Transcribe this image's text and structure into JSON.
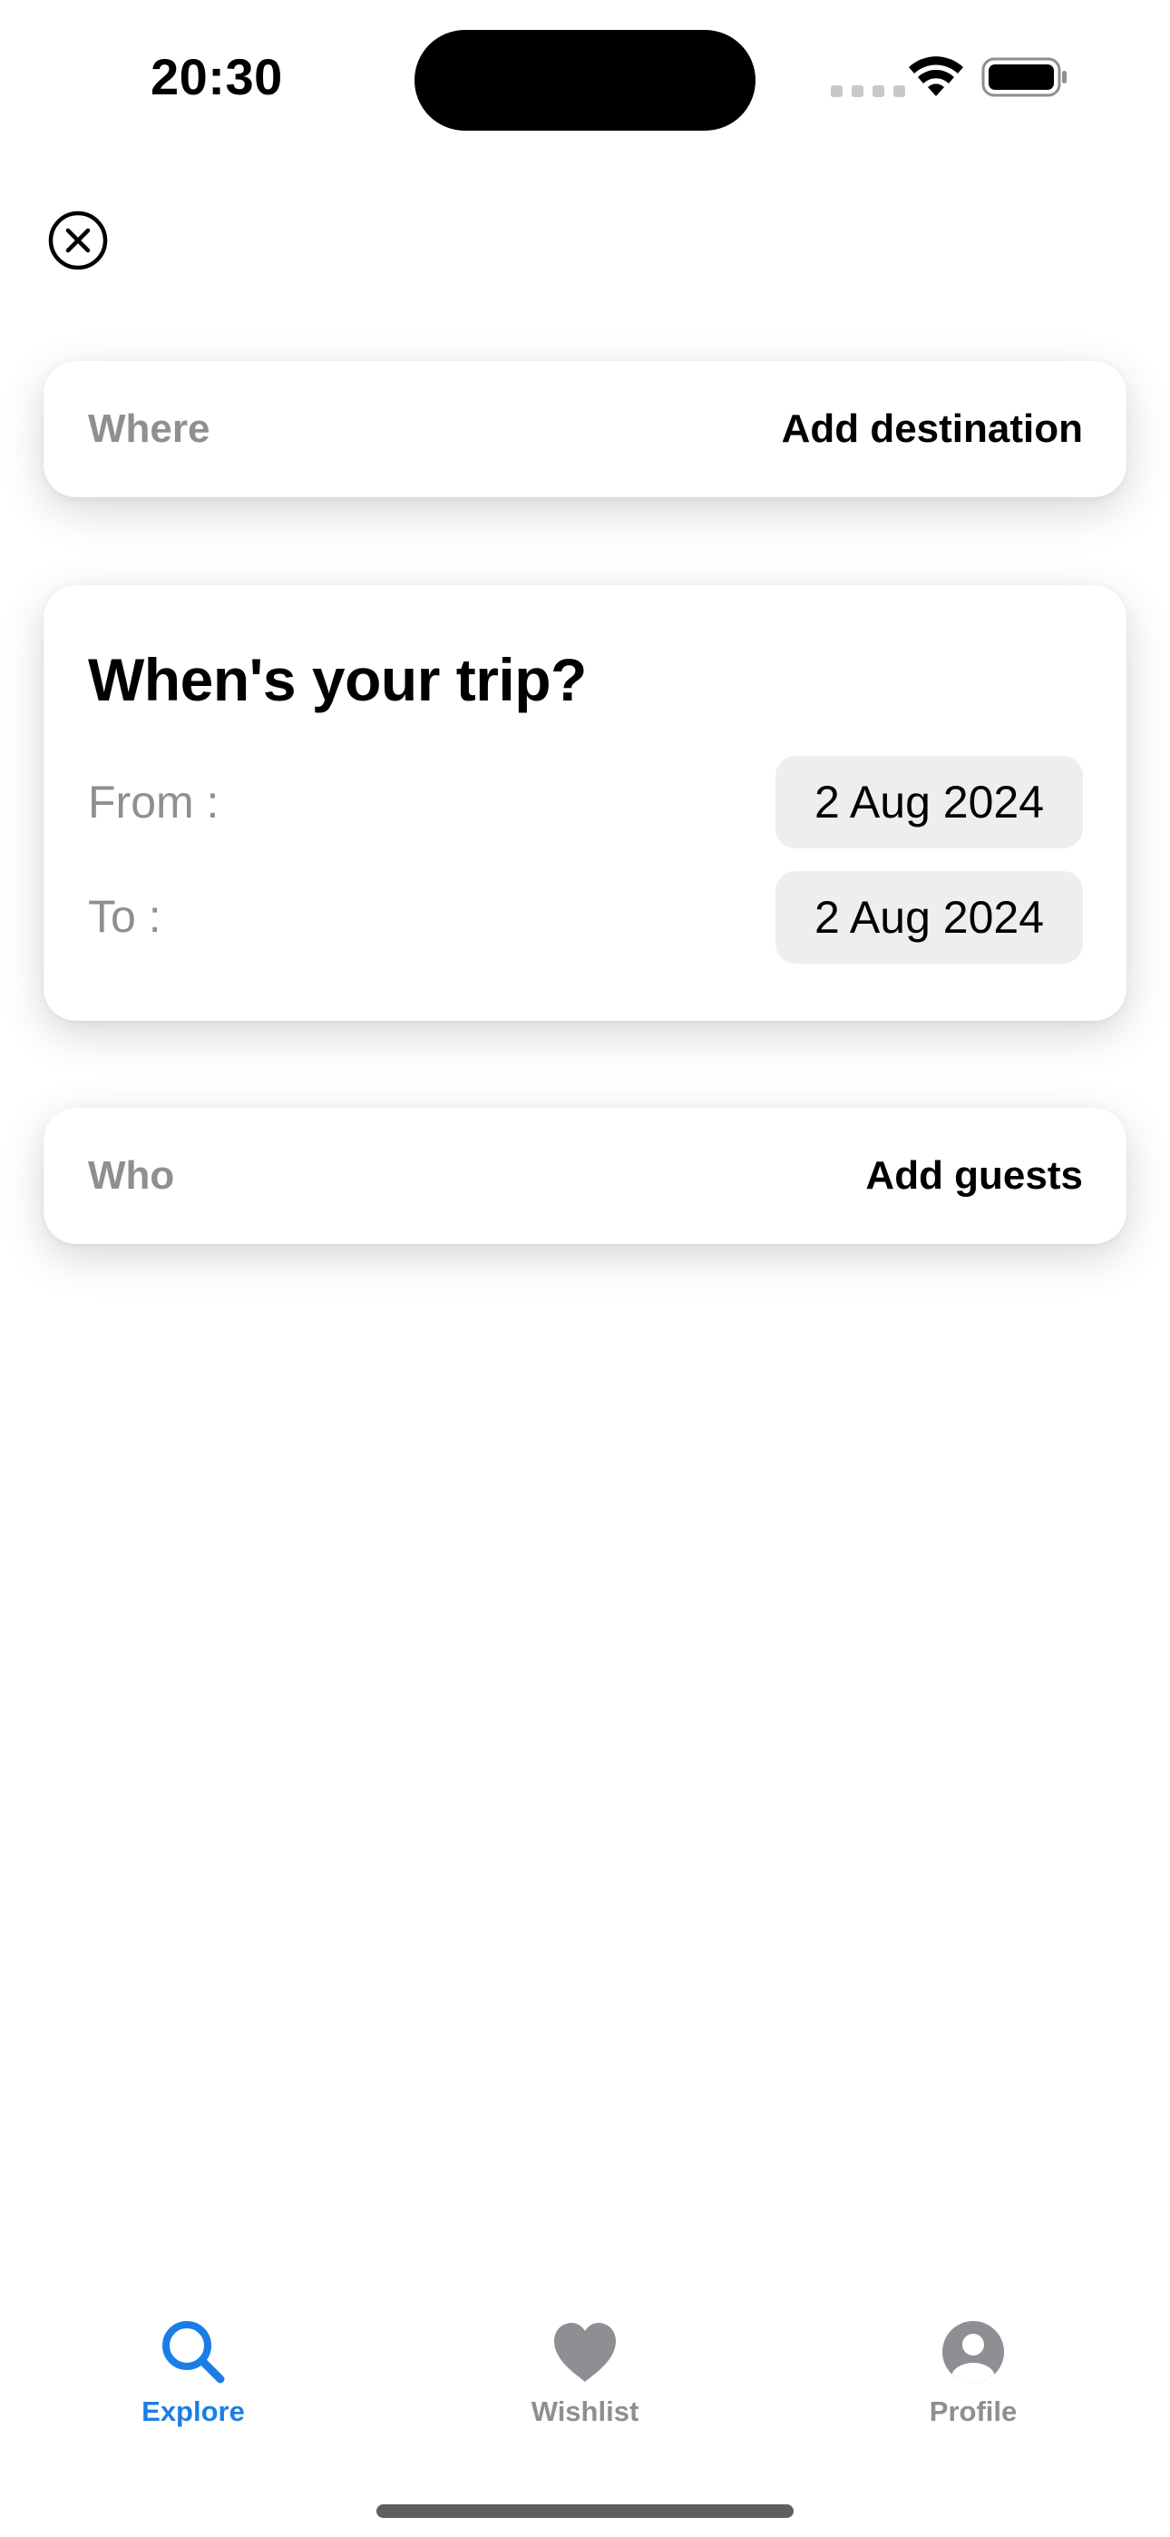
{
  "status_bar": {
    "time": "20:30"
  },
  "search": {
    "where": {
      "label": "Where",
      "value": "Add destination"
    },
    "when": {
      "title": "When's your trip?",
      "from_label": "From :",
      "from_value": "2 Aug 2024",
      "to_label": "To :",
      "to_value": "2 Aug 2024"
    },
    "who": {
      "label": "Who",
      "value": "Add guests"
    }
  },
  "tab_bar": {
    "items": [
      {
        "label": "Explore",
        "icon": "search-icon",
        "active": true
      },
      {
        "label": "Wishlist",
        "icon": "heart-icon",
        "active": false
      },
      {
        "label": "Profile",
        "icon": "person-icon",
        "active": false
      }
    ]
  },
  "colors": {
    "accent": "#1a7ee6",
    "secondary_text": "#8e8e93",
    "pill_background": "#eeeeef"
  }
}
